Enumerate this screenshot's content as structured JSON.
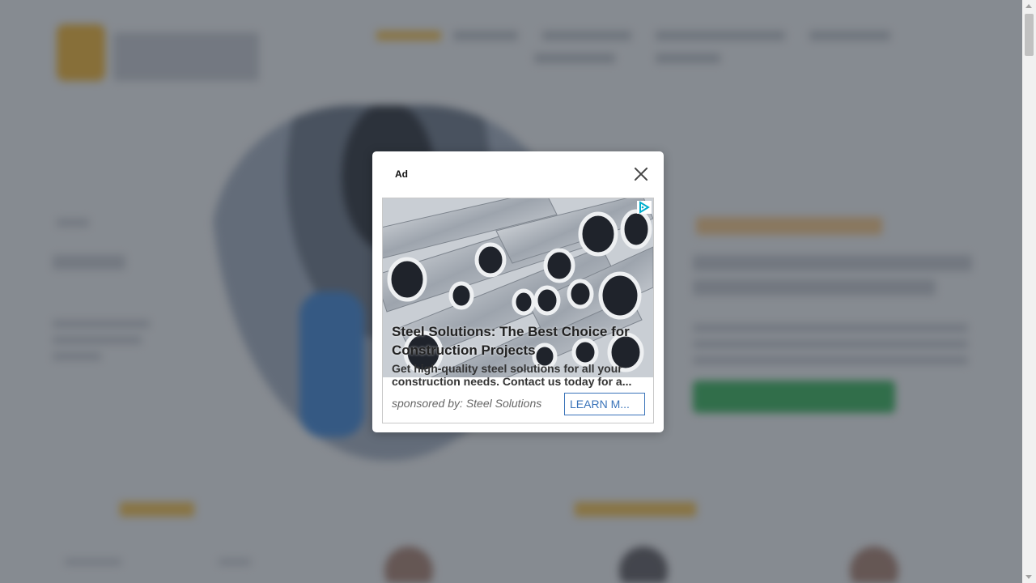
{
  "modal": {
    "ad_label": "Ad",
    "headline": "Steel Solutions: The Best Choice for Construction Projects",
    "description": "Get high-quality steel solutions for all your construction needs. Contact us today for a...",
    "sponsor": "sponsored by: Steel Solutions",
    "cta_label": "LEARN M...",
    "icons": {
      "close": "close-icon",
      "adchoices": "adchoices-icon",
      "image": "steel-pipes-image"
    }
  },
  "colors": {
    "overlay": "#2d343e",
    "cta_border": "#3973b9",
    "accent_orange": "#f6c24e",
    "accent_green": "#36b35a"
  }
}
